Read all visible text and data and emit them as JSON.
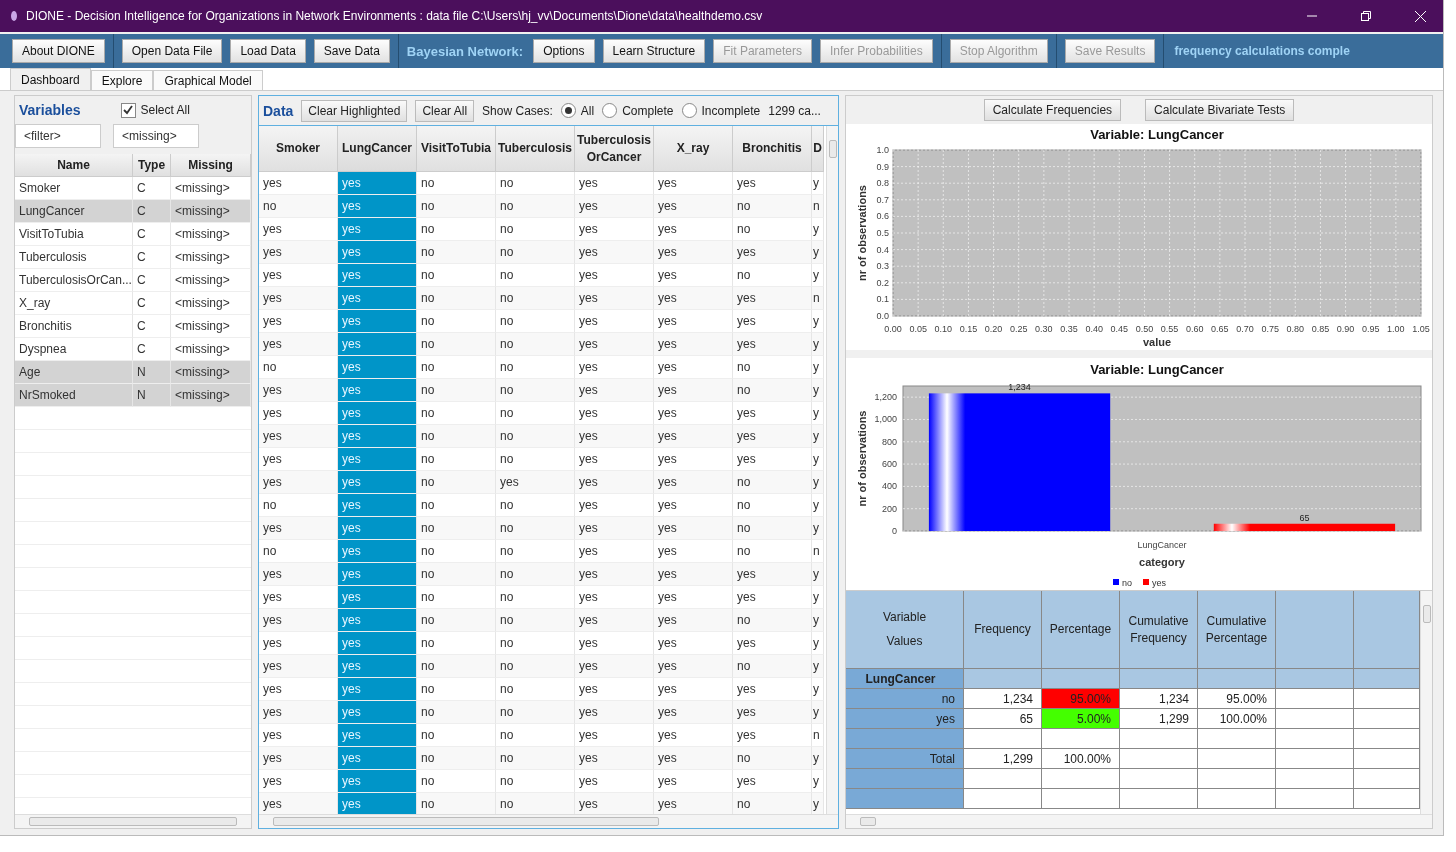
{
  "window": {
    "title": "DIONE - Decision Intelligence for Organizations in Network Environments : data file C:\\Users\\hj_vv\\Documents\\Dione\\data\\healthdemo.csv"
  },
  "toolbar": [
    {
      "kind": "button",
      "label": "About DIONE",
      "disabled": false
    },
    {
      "kind": "button",
      "label": "Open Data File",
      "disabled": false
    },
    {
      "kind": "button",
      "label": "Load Data",
      "disabled": false
    },
    {
      "kind": "button",
      "label": "Save Data",
      "disabled": false
    },
    {
      "kind": "label",
      "label": "Bayesian Network:"
    },
    {
      "kind": "button",
      "label": "Options",
      "disabled": false
    },
    {
      "kind": "button",
      "label": "Learn Structure",
      "disabled": false
    },
    {
      "kind": "button",
      "label": "Fit Parameters",
      "disabled": true
    },
    {
      "kind": "button",
      "label": "Infer Probabilities",
      "disabled": true
    },
    {
      "kind": "button",
      "label": "Stop Algorithm",
      "disabled": true
    },
    {
      "kind": "button",
      "label": "Save Results",
      "disabled": true
    },
    {
      "kind": "status",
      "label": "frequency calculations comple"
    }
  ],
  "tabs": [
    {
      "label": "Dashboard",
      "selected": true
    },
    {
      "label": "Explore",
      "selected": false
    },
    {
      "label": "Graphical Model",
      "selected": false
    }
  ],
  "variables": {
    "title": "Variables",
    "select_all": {
      "label": "Select All",
      "checked": true
    },
    "filter": {
      "placeholder": "<filter>"
    },
    "missing": {
      "placeholder": "<missing>"
    },
    "columns": [
      "Name",
      "Type",
      "Missing"
    ],
    "rows": [
      {
        "name": "Smoker",
        "type": "C",
        "missing": "<missing>",
        "selected": false
      },
      {
        "name": "LungCancer",
        "type": "C",
        "missing": "<missing>",
        "selected": true
      },
      {
        "name": "VisitToTubia",
        "type": "C",
        "missing": "<missing>",
        "selected": false
      },
      {
        "name": "Tuberculosis",
        "type": "C",
        "missing": "<missing>",
        "selected": false
      },
      {
        "name": "TuberculosisOrCan...",
        "type": "C",
        "missing": "<missing>",
        "selected": false
      },
      {
        "name": "X_ray",
        "type": "C",
        "missing": "<missing>",
        "selected": false
      },
      {
        "name": "Bronchitis",
        "type": "C",
        "missing": "<missing>",
        "selected": false
      },
      {
        "name": "Dyspnea",
        "type": "C",
        "missing": "<missing>",
        "selected": false
      },
      {
        "name": "Age",
        "type": "N",
        "missing": "<missing>",
        "selected": true
      },
      {
        "name": "NrSmoked",
        "type": "N",
        "missing": "<missing>",
        "selected": true
      }
    ]
  },
  "data": {
    "title": "Data",
    "buttons": [
      "Clear Highlighted",
      "Clear All"
    ],
    "show_cases_label": "Show Cases:",
    "show_cases": [
      {
        "label": "All",
        "selected": true
      },
      {
        "label": "Complete",
        "selected": false
      },
      {
        "label": "Incomplete",
        "selected": false
      }
    ],
    "count": "1299 ca...",
    "columns": [
      {
        "label": "Smoker",
        "selected": false
      },
      {
        "label": "LungCancer",
        "selected": true
      },
      {
        "label": "VisitToTubia",
        "selected": false
      },
      {
        "label": "Tuberculosis",
        "selected": false
      },
      {
        "label": "Tuberculosis OrCancer",
        "selected": false
      },
      {
        "label": "X_ray",
        "selected": false
      },
      {
        "label": "Bronchitis",
        "selected": false
      },
      {
        "label": "D",
        "selected": false
      }
    ],
    "rows": [
      [
        "yes",
        "yes",
        "no",
        "no",
        "yes",
        "yes",
        "yes",
        "y"
      ],
      [
        "no",
        "yes",
        "no",
        "no",
        "yes",
        "yes",
        "no",
        "n"
      ],
      [
        "yes",
        "yes",
        "no",
        "no",
        "yes",
        "yes",
        "no",
        "y"
      ],
      [
        "yes",
        "yes",
        "no",
        "no",
        "yes",
        "yes",
        "yes",
        "y"
      ],
      [
        "yes",
        "yes",
        "no",
        "no",
        "yes",
        "yes",
        "no",
        "y"
      ],
      [
        "yes",
        "yes",
        "no",
        "no",
        "yes",
        "yes",
        "yes",
        "n"
      ],
      [
        "yes",
        "yes",
        "no",
        "no",
        "yes",
        "yes",
        "yes",
        "y"
      ],
      [
        "yes",
        "yes",
        "no",
        "no",
        "yes",
        "yes",
        "yes",
        "y"
      ],
      [
        "no",
        "yes",
        "no",
        "no",
        "yes",
        "yes",
        "no",
        "y"
      ],
      [
        "yes",
        "yes",
        "no",
        "no",
        "yes",
        "yes",
        "no",
        "y"
      ],
      [
        "yes",
        "yes",
        "no",
        "no",
        "yes",
        "yes",
        "yes",
        "y"
      ],
      [
        "yes",
        "yes",
        "no",
        "no",
        "yes",
        "yes",
        "yes",
        "y"
      ],
      [
        "yes",
        "yes",
        "no",
        "no",
        "yes",
        "yes",
        "yes",
        "y"
      ],
      [
        "yes",
        "yes",
        "no",
        "yes",
        "yes",
        "yes",
        "no",
        "y"
      ],
      [
        "no",
        "yes",
        "no",
        "no",
        "yes",
        "yes",
        "no",
        "y"
      ],
      [
        "yes",
        "yes",
        "no",
        "no",
        "yes",
        "yes",
        "no",
        "y"
      ],
      [
        "no",
        "yes",
        "no",
        "no",
        "yes",
        "yes",
        "no",
        "n"
      ],
      [
        "yes",
        "yes",
        "no",
        "no",
        "yes",
        "yes",
        "yes",
        "y"
      ],
      [
        "yes",
        "yes",
        "no",
        "no",
        "yes",
        "yes",
        "yes",
        "y"
      ],
      [
        "yes",
        "yes",
        "no",
        "no",
        "yes",
        "yes",
        "no",
        "y"
      ],
      [
        "yes",
        "yes",
        "no",
        "no",
        "yes",
        "yes",
        "yes",
        "y"
      ],
      [
        "yes",
        "yes",
        "no",
        "no",
        "yes",
        "yes",
        "no",
        "y"
      ],
      [
        "yes",
        "yes",
        "no",
        "no",
        "yes",
        "yes",
        "yes",
        "y"
      ],
      [
        "yes",
        "yes",
        "no",
        "no",
        "yes",
        "yes",
        "yes",
        "y"
      ],
      [
        "yes",
        "yes",
        "no",
        "no",
        "yes",
        "yes",
        "yes",
        "n"
      ],
      [
        "yes",
        "yes",
        "no",
        "no",
        "yes",
        "yes",
        "no",
        "y"
      ],
      [
        "yes",
        "yes",
        "no",
        "no",
        "yes",
        "yes",
        "yes",
        "y"
      ],
      [
        "yes",
        "yes",
        "no",
        "no",
        "yes",
        "yes",
        "no",
        "y"
      ]
    ]
  },
  "analysis": {
    "buttons": [
      "Calculate Frequencies",
      "Calculate Bivariate Tests"
    ],
    "distribution_chart": {
      "chart_data": {
        "type": "scatter",
        "title": "Variable: LungCancer",
        "xlabel": "value",
        "ylabel": "nr of observations",
        "xlim": [
          0,
          1.05
        ],
        "ylim": [
          0,
          1.0
        ],
        "grid": true,
        "xticks": [
          {
            "value": 0,
            "label": "0.00"
          },
          {
            "value": 0.05,
            "label": "0.05"
          },
          {
            "value": 0.1,
            "label": "0.10"
          },
          {
            "value": 0.15,
            "label": "0.15"
          },
          {
            "value": 0.2,
            "label": "0.20"
          },
          {
            "value": 0.25,
            "label": "0.25"
          },
          {
            "value": 0.3,
            "label": "0.30"
          },
          {
            "value": 0.35,
            "label": "0.35"
          },
          {
            "value": 0.4,
            "label": "0.40"
          },
          {
            "value": 0.45,
            "label": "0.45"
          },
          {
            "value": 0.5,
            "label": "0.50"
          },
          {
            "value": 0.55,
            "label": "0.55"
          },
          {
            "value": 0.6,
            "label": "0.60"
          },
          {
            "value": 0.65,
            "label": "0.65"
          },
          {
            "value": 0.7,
            "label": "0.70"
          },
          {
            "value": 0.75,
            "label": "0.75"
          },
          {
            "value": 0.8,
            "label": "0.80"
          },
          {
            "value": 0.85,
            "label": "0.85"
          },
          {
            "value": 0.9,
            "label": "0.90"
          },
          {
            "value": 0.95,
            "label": "0.95"
          },
          {
            "value": 1.0,
            "label": "1.00"
          },
          {
            "value": 1.05,
            "label": "1.05"
          }
        ],
        "yticks": [
          {
            "value": 0,
            "label": "0.0"
          },
          {
            "value": 0.1,
            "label": "0.1"
          },
          {
            "value": 0.2,
            "label": "0.2"
          },
          {
            "value": 0.3,
            "label": "0.3"
          },
          {
            "value": 0.4,
            "label": "0.4"
          },
          {
            "value": 0.5,
            "label": "0.5"
          },
          {
            "value": 0.6,
            "label": "0.6"
          },
          {
            "value": 0.7,
            "label": "0.7"
          },
          {
            "value": 0.8,
            "label": "0.8"
          },
          {
            "value": 0.9,
            "label": "0.9"
          },
          {
            "value": 1.0,
            "label": "1.0"
          }
        ]
      }
    },
    "category_chart": {
      "chart_data": {
        "type": "bar",
        "title": "Variable: LungCancer",
        "xlabel": "category",
        "ylabel": "nr of observations",
        "categories": [
          "LungCancer"
        ],
        "ylim": [
          0,
          1300
        ],
        "grid": true,
        "legend": true,
        "yticks": [
          {
            "value": 0,
            "label": "0"
          },
          {
            "value": 200,
            "label": "200"
          },
          {
            "value": 400,
            "label": "400"
          },
          {
            "value": 600,
            "label": "600"
          },
          {
            "value": 800,
            "label": "800"
          },
          {
            "value": 1000,
            "label": "1,000"
          },
          {
            "value": 1200,
            "label": "1,200"
          }
        ],
        "series": [
          {
            "name": "no",
            "color": "#0000ff",
            "values": [
              1234
            ]
          },
          {
            "name": "yes",
            "color": "#ff0000",
            "values": [
              65
            ]
          }
        ],
        "value_labels": [
          "1,234",
          "65"
        ]
      }
    },
    "frequency_table": {
      "header_top": "Variable",
      "header_bottom": "Values",
      "columns": [
        "Frequency",
        "Percentage",
        "Cumulative Frequency",
        "Cumulative Percentage"
      ],
      "rows": [
        {
          "kind": "group",
          "label": "LungCancer"
        },
        {
          "kind": "value",
          "label": "no",
          "cells": [
            "1,234",
            "95.00%",
            "1,234",
            "95.00%"
          ],
          "color": "#ff0000"
        },
        {
          "kind": "value",
          "label": "yes",
          "cells": [
            "65",
            "5.00%",
            "1,299",
            "100.00%"
          ],
          "color": "#44ff00"
        },
        {
          "kind": "blank"
        },
        {
          "kind": "total",
          "label": "Total",
          "cells": [
            "1,299",
            "100.00%"
          ]
        },
        {
          "kind": "blank"
        },
        {
          "kind": "blank"
        }
      ]
    }
  }
}
